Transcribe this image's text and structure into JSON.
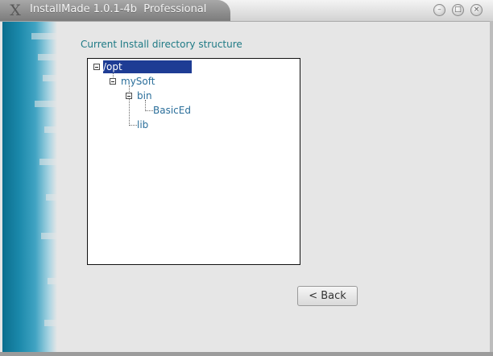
{
  "window": {
    "title": "InstallMade 1.0.1-4b  Professional",
    "controls": {
      "minimize": "–",
      "maximize": "□",
      "close": "×"
    }
  },
  "logo_glyph": "X",
  "heading": "Current Install directory structure",
  "tree": {
    "nodes": [
      {
        "label": "/opt",
        "selected": true,
        "expanded": true
      },
      {
        "label": "mySoft",
        "expanded": true
      },
      {
        "label": "bin",
        "expanded": true
      },
      {
        "label": "BasicEd"
      },
      {
        "label": "lib"
      }
    ],
    "selection_color": "#1e3c94",
    "text_color": "#2a6e9a"
  },
  "buttons": {
    "back": "< Back"
  },
  "colors": {
    "accent": "#1f7a85",
    "side_panel": "#1a88aa"
  }
}
